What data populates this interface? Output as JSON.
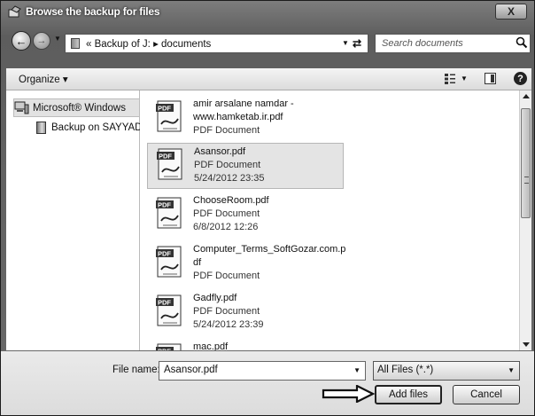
{
  "window": {
    "title": "Browse the backup for files",
    "close_label": "X"
  },
  "nav": {
    "crumbs": [
      "«",
      "Backup of J:",
      "▸",
      "documents"
    ],
    "crumbs_text": "«  Backup of J:  ▸  documents",
    "search_placeholder": "Search documents"
  },
  "toolbar": {
    "organize_label": "Organize ▾",
    "help_label": "?"
  },
  "sidebar": {
    "items": [
      {
        "label": "Microsoft® Windows",
        "icon": "computer-icon",
        "selected": true
      },
      {
        "label": "Backup on SAYYAD",
        "icon": "drive-icon",
        "selected": false
      }
    ]
  },
  "files": [
    {
      "lines": [
        "amir arsalane namdar -",
        "www.hamketab.ir.pdf",
        "PDF Document"
      ],
      "selected": false
    },
    {
      "lines": [
        "Asansor.pdf",
        "PDF Document",
        "5/24/2012 23:35"
      ],
      "selected": true
    },
    {
      "lines": [
        "ChooseRoom.pdf",
        "PDF Document",
        "6/8/2012 12:26"
      ],
      "selected": false
    },
    {
      "lines": [
        "Computer_Terms_SoftGozar.com.p",
        "df",
        "PDF Document"
      ],
      "selected": false
    },
    {
      "lines": [
        "Gadfly.pdf",
        "PDF Document",
        "5/24/2012 23:39"
      ],
      "selected": false
    },
    {
      "lines": [
        "mac.pdf"
      ],
      "selected": false
    }
  ],
  "footer": {
    "file_name_label": "File name:",
    "file_name_value": "Asansor.pdf",
    "file_type_value": "All Files (*.*)",
    "add_files_label": "Add files",
    "cancel_label": "Cancel"
  },
  "icons": {
    "pdf": "pdf-icon",
    "arrow": "right-arrow-icon"
  }
}
